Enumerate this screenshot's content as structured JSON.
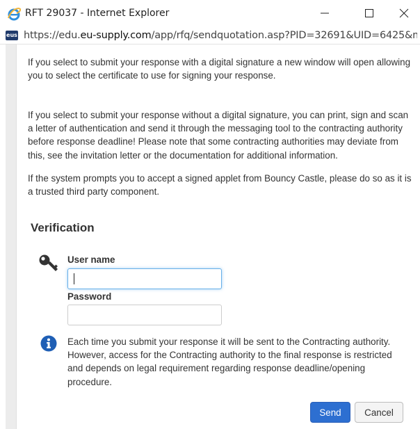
{
  "window": {
    "title": "RFT 29037 - Internet Explorer",
    "url_prefix": "https://edu.",
    "url_domain": "eu-supply.com",
    "url_rest": "/app/rfq/sendquotation.asp?PID=32691&UID=6425&m",
    "site_icon_text": "eus"
  },
  "content": {
    "paragraph_1": "If you select to submit your response with a digital signature a new window will open allowing you to select the certificate to use for signing your response.",
    "paragraph_2": "If you select to submit your response without a digital signature, you can print, sign and scan a letter of authentication and send it through the messaging tool to the contracting authority before response deadline! Please note that some contracting authorities may deviate from this, see the invitation letter or the documentation for additional information.",
    "paragraph_3": "If the system prompts you to accept a signed applet from Bouncy Castle, please do so as it is a trusted third party component."
  },
  "verification": {
    "heading": "Verification",
    "username_label": "User name",
    "username_value": "",
    "password_label": "Password",
    "password_value": "",
    "info_text": "Each time you submit your response it will be sent to the Contracting authority. However, access for the Contracting authority to the final response is restricted and depends on legal requirement regarding response deadline/opening procedure."
  },
  "buttons": {
    "send": "Send",
    "cancel": "Cancel"
  },
  "icons": {
    "browser": "internet-explorer-icon",
    "key": "key-icon",
    "info": "info-icon"
  },
  "colors": {
    "primary_button": "#2d6fd1",
    "info_icon": "#1f5fb5",
    "focus_border": "#66afe9"
  }
}
